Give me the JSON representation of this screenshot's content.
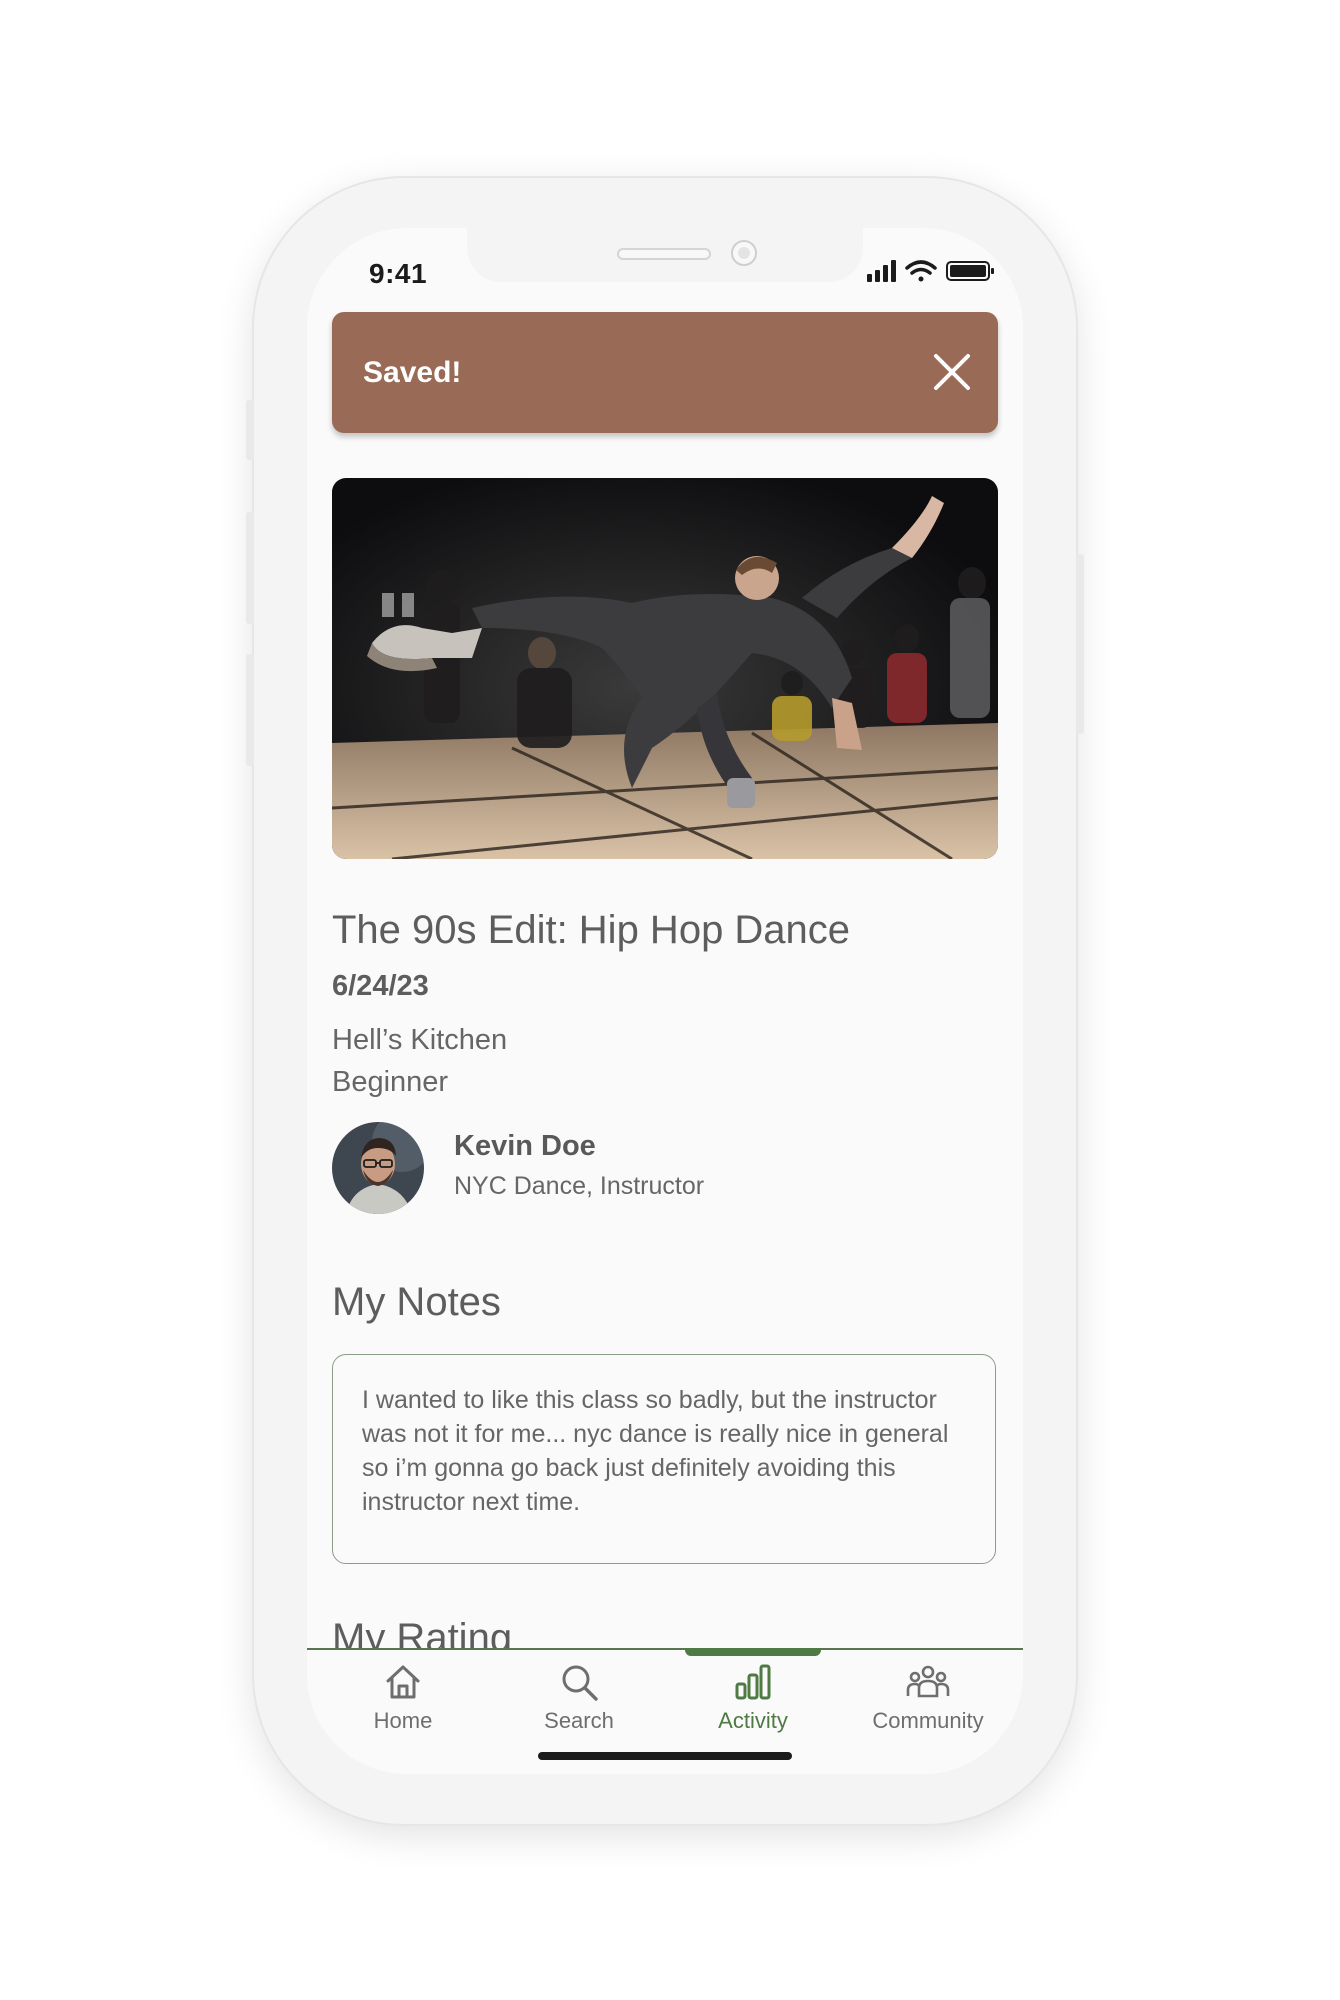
{
  "status_bar": {
    "time": "9:41"
  },
  "toast": {
    "message": "Saved!",
    "close_icon": "close-icon"
  },
  "event": {
    "title": "The 90s Edit: Hip Hop Dance",
    "date": "6/24/23",
    "location": "Hell’s Kitchen",
    "level": "Beginner"
  },
  "instructor": {
    "name": "Kevin Doe",
    "subtitle": "NYC Dance, Instructor"
  },
  "notes": {
    "heading": "My Notes",
    "text": "I wanted to like this class so badly, but the instructor was not it for me... nyc dance is really nice in general so i’m gonna go back just definitely avoiding this instructor next time."
  },
  "rating": {
    "heading": "My Rating"
  },
  "tabs": [
    {
      "label": "Home",
      "icon": "home-icon"
    },
    {
      "label": "Search",
      "icon": "search-icon"
    },
    {
      "label": "Activity",
      "icon": "activity-icon",
      "active": true
    },
    {
      "label": "Community",
      "icon": "community-icon"
    }
  ],
  "colors": {
    "toast": "#996b56",
    "accent": "#4f7a43"
  }
}
